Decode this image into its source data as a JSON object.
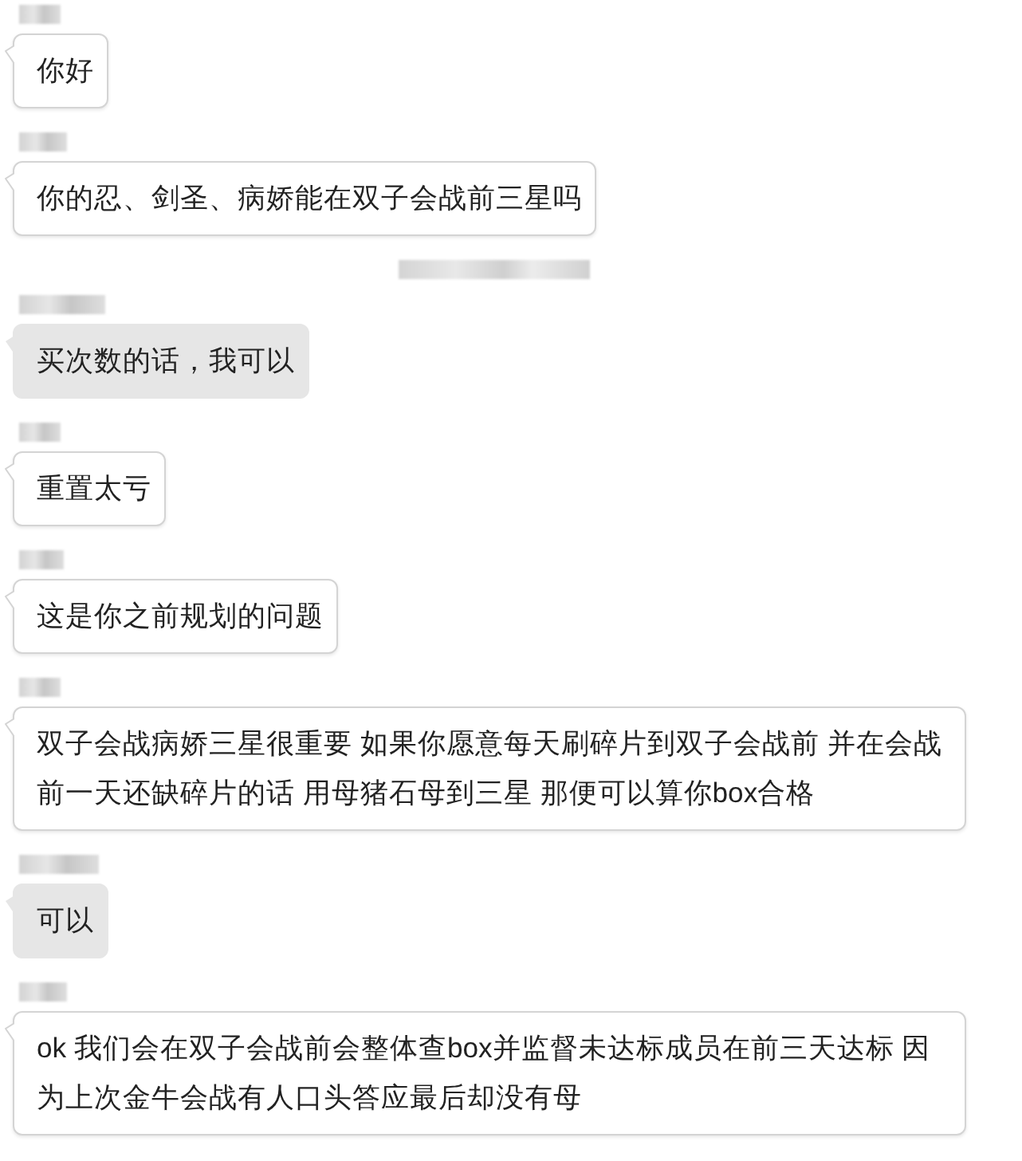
{
  "chat": {
    "items": [
      {
        "kind": "outlined",
        "sender_blurred": true,
        "text": "你好"
      },
      {
        "kind": "outlined",
        "sender_blurred": true,
        "text": "你的忍、剑圣、病娇能在双子会战前三星吗"
      },
      {
        "kind": "timestamp"
      },
      {
        "kind": "shaded",
        "sender_blurred": true,
        "text": "买次数的话，我可以"
      },
      {
        "kind": "outlined",
        "sender_blurred": true,
        "text": "重置太亏"
      },
      {
        "kind": "outlined",
        "sender_blurred": true,
        "text": "这是你之前规划的问题"
      },
      {
        "kind": "outlined",
        "sender_blurred": true,
        "text": "双子会战病娇三星很重要 如果你愿意每天刷碎片到双子会战前 并在会战前一天还缺碎片的话 用母猪石母到三星 那便可以算你box合格"
      },
      {
        "kind": "shaded",
        "sender_blurred": true,
        "text": "可以"
      },
      {
        "kind": "outlined",
        "sender_blurred": true,
        "text": "ok 我们会在双子会战前会整体查box并监督未达标成员在前三天达标 因为上次金牛会战有人口头答应最后却没有母"
      }
    ]
  }
}
